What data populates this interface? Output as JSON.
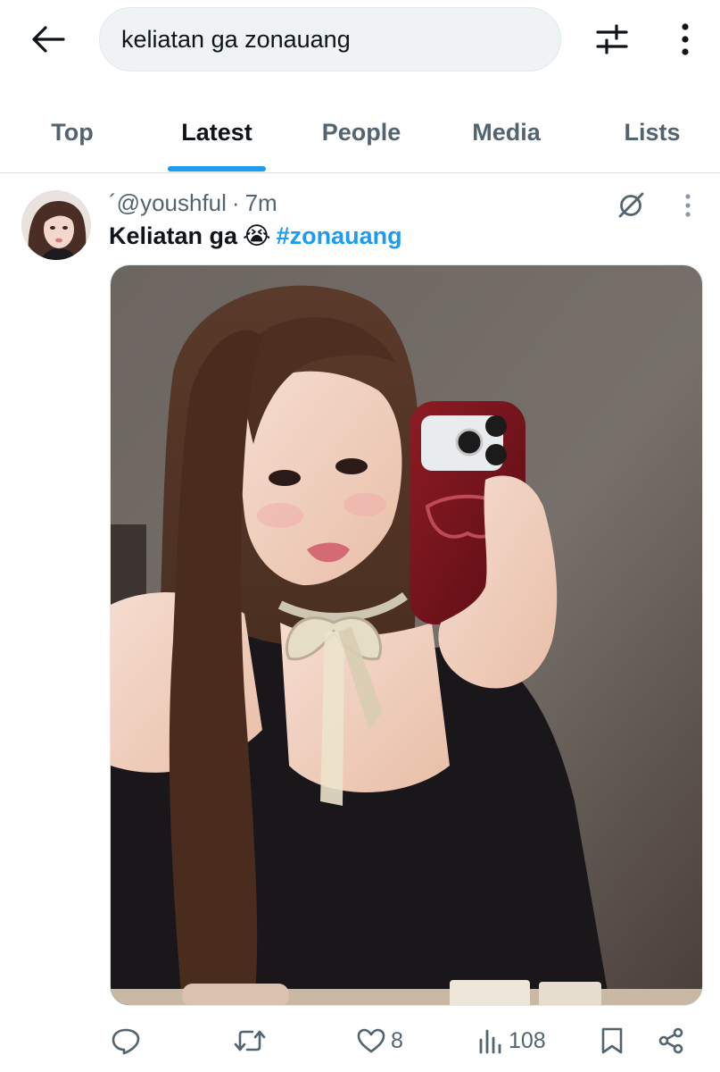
{
  "search": {
    "query": "keliatan ga zonauang"
  },
  "icons": {
    "back": "arrow-left-icon",
    "filter": "sliders-icon",
    "more": "vertical-dots-icon",
    "grok": "grok-icon",
    "reply": "reply-icon",
    "retweet": "retweet-icon",
    "like": "heart-icon",
    "views": "bar-chart-icon",
    "bookmark": "bookmark-icon",
    "share": "share-icon"
  },
  "tabs": [
    {
      "label": "Top",
      "active": false
    },
    {
      "label": "Latest",
      "active": true
    },
    {
      "label": "People",
      "active": false
    },
    {
      "label": "Media",
      "active": false
    },
    {
      "label": "Lists",
      "active": false
    }
  ],
  "tweet": {
    "handle_prefix": "´",
    "handle": "@youshful",
    "separator": "·",
    "time": "7m",
    "text": "Keliatan ga",
    "emoji": "😭",
    "hashtag": "#zonauang",
    "stats": {
      "likes": "8",
      "views": "108"
    }
  },
  "colors": {
    "accent": "#1d9bf0",
    "text_primary": "#0f1419",
    "text_secondary": "#536471"
  }
}
